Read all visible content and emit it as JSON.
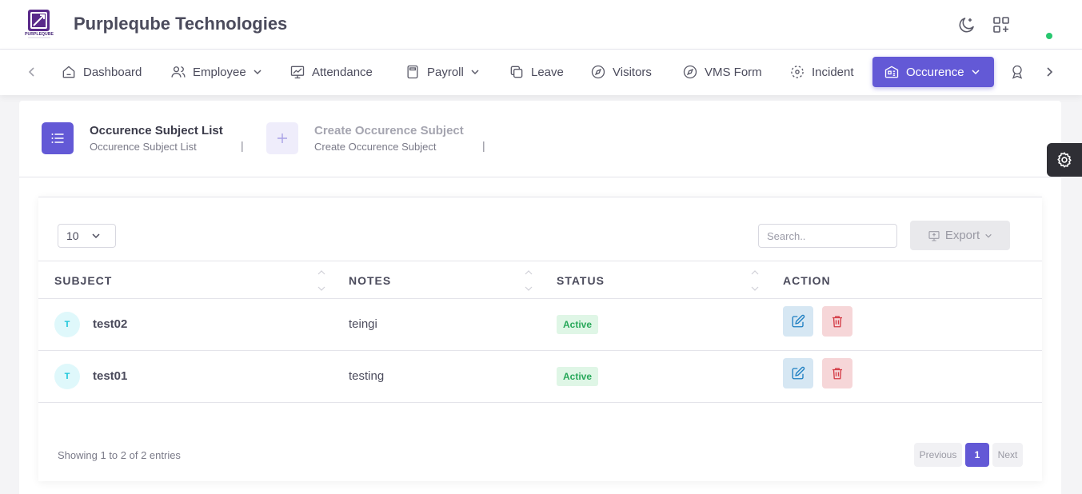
{
  "app": {
    "brand_name": "Purpleqube Technologies",
    "logo_text": "PURPLEQUBE"
  },
  "navbar": {
    "items": [
      {
        "label": "Dashboard",
        "icon": "home-icon"
      },
      {
        "label": "Employee",
        "icon": "users-icon",
        "has_dropdown": true
      },
      {
        "label": "Attendance",
        "icon": "chart-icon"
      },
      {
        "label": "Payroll",
        "icon": "calculator-icon",
        "has_dropdown": true
      },
      {
        "label": "Leave",
        "icon": "copy-icon"
      },
      {
        "label": "Visitors",
        "icon": "compass-icon"
      },
      {
        "label": "VMS Form",
        "icon": "compass-icon"
      },
      {
        "label": "Incident",
        "icon": "focus-icon"
      },
      {
        "label": "Occurence",
        "icon": "building-icon",
        "has_dropdown": true,
        "active": true
      }
    ]
  },
  "steps": [
    {
      "title": "Occurence Subject List",
      "subtitle": "Occurence Subject List",
      "active": true
    },
    {
      "title": "Create Occurence Subject",
      "subtitle": "Create Occurence Subject",
      "active": false
    }
  ],
  "separator": "|",
  "table": {
    "page_size": "10",
    "search_placeholder": "Search..",
    "export_label": "Export",
    "columns": [
      "SUBJECT",
      "NOTES",
      "STATUS",
      "ACTION"
    ],
    "rows": [
      {
        "initial": "T",
        "subject": "test02",
        "notes": "teingi",
        "status": "Active"
      },
      {
        "initial": "T",
        "subject": "test01",
        "notes": "testing",
        "status": "Active"
      }
    ],
    "info": "Showing 1 to 2 of 2 entries",
    "pagination": {
      "previous": "Previous",
      "current": "1",
      "next": "Next"
    }
  },
  "colors": {
    "accent": "#6359d6",
    "status_active": "#28a85a",
    "online": "#28c76f",
    "edit": "#1e7fc2",
    "delete": "#d43b45"
  }
}
